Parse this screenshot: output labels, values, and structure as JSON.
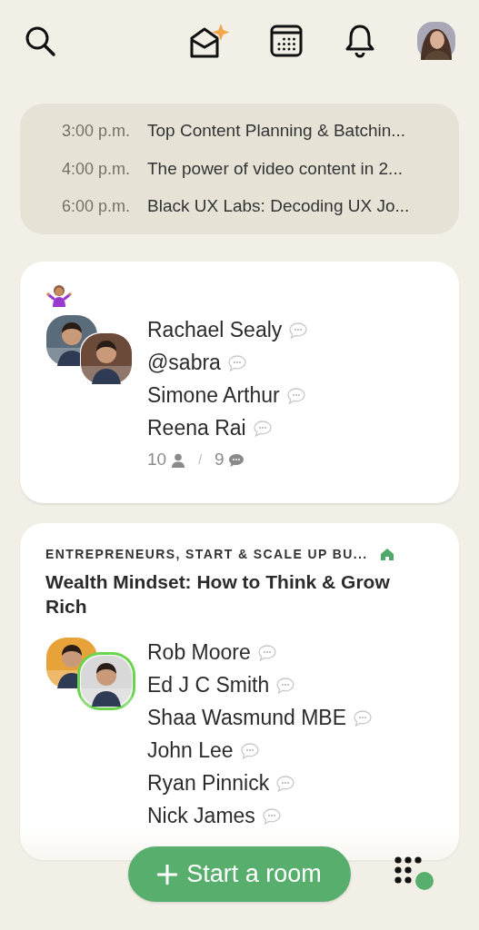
{
  "header": {
    "has_new_invites": true
  },
  "upcoming": [
    {
      "time": "3:00 p.m.",
      "title": "Top Content Planning & Batchin..."
    },
    {
      "time": "4:00 p.m.",
      "title": "The power of video content in 2..."
    },
    {
      "time": "6:00 p.m.",
      "title": "Black UX Labs: Decoding UX Jo..."
    }
  ],
  "rooms": [
    {
      "has_emoji": true,
      "avatars": [
        {
          "speaking": false
        },
        {
          "speaking": false
        }
      ],
      "speakers": [
        "Rachael Sealy",
        "@sabra",
        "Simone Arthur",
        "Reena Rai"
      ],
      "listeners": "10",
      "separator": "/",
      "speaker_count": "9"
    },
    {
      "club": "ENTREPRENEURS, START & SCALE UP BU...",
      "title": "Wealth Mindset: How to Think & Grow Rich",
      "has_emoji": false,
      "avatars": [
        {
          "speaking": false
        },
        {
          "speaking": true
        }
      ],
      "speakers": [
        "Rob Moore",
        "Ed J C Smith",
        "Shaa Wasmund MBE",
        "John Lee",
        "Ryan Pinnick",
        "Nick James"
      ]
    }
  ],
  "start_button": {
    "label": "Start a room"
  },
  "online_status": {
    "on": true
  }
}
